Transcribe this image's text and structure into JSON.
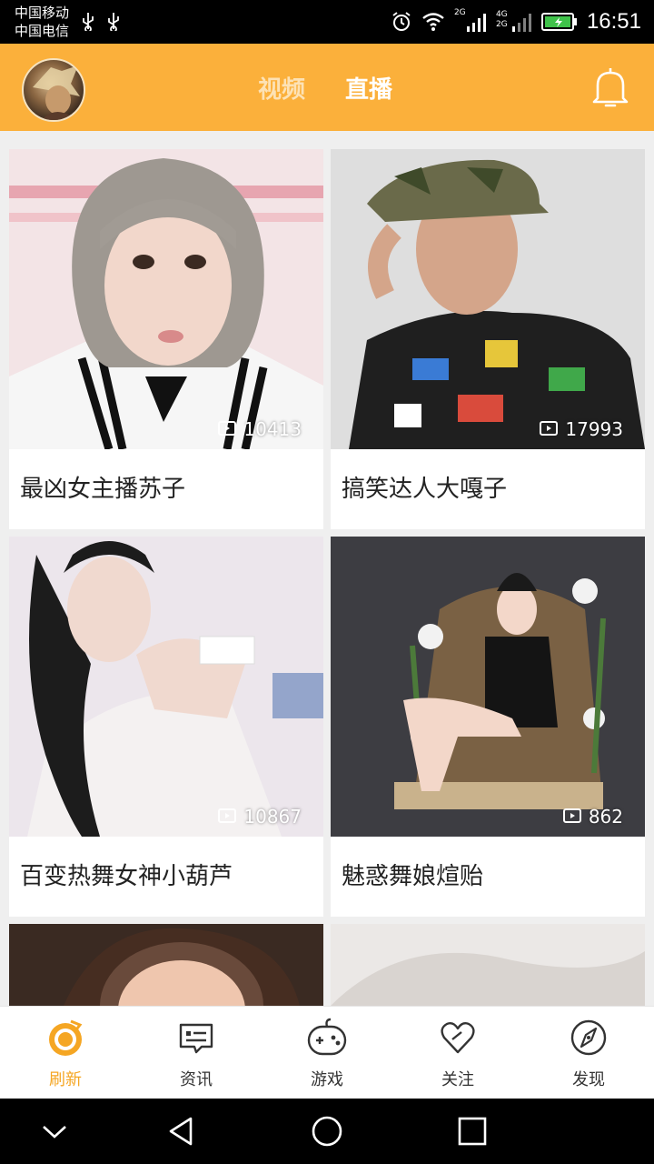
{
  "status": {
    "carrier1": "中国移动",
    "carrier2": "中国电信",
    "net1": "2G",
    "net2": "4G",
    "net3": "2G",
    "time": "16:51"
  },
  "header": {
    "tabs": [
      "视频",
      "直播"
    ],
    "active_tab": "直播",
    "accent_color": "#fbb03b"
  },
  "cards": [
    {
      "title": "最凶女主播苏子",
      "viewers": "10413"
    },
    {
      "title": "搞笑达人大嘎子",
      "viewers": "17993"
    },
    {
      "title": "百变热舞女神小葫芦",
      "viewers": "10867"
    },
    {
      "title": "魅惑舞娘煊贻",
      "viewers": "862"
    }
  ],
  "bottom_nav": [
    {
      "label": "刷新",
      "icon": "refresh-icon",
      "active": true
    },
    {
      "label": "资讯",
      "icon": "news-icon",
      "active": false
    },
    {
      "label": "游戏",
      "icon": "gamepad-icon",
      "active": false
    },
    {
      "label": "关注",
      "icon": "heart-icon",
      "active": false
    },
    {
      "label": "发现",
      "icon": "compass-icon",
      "active": false
    }
  ]
}
